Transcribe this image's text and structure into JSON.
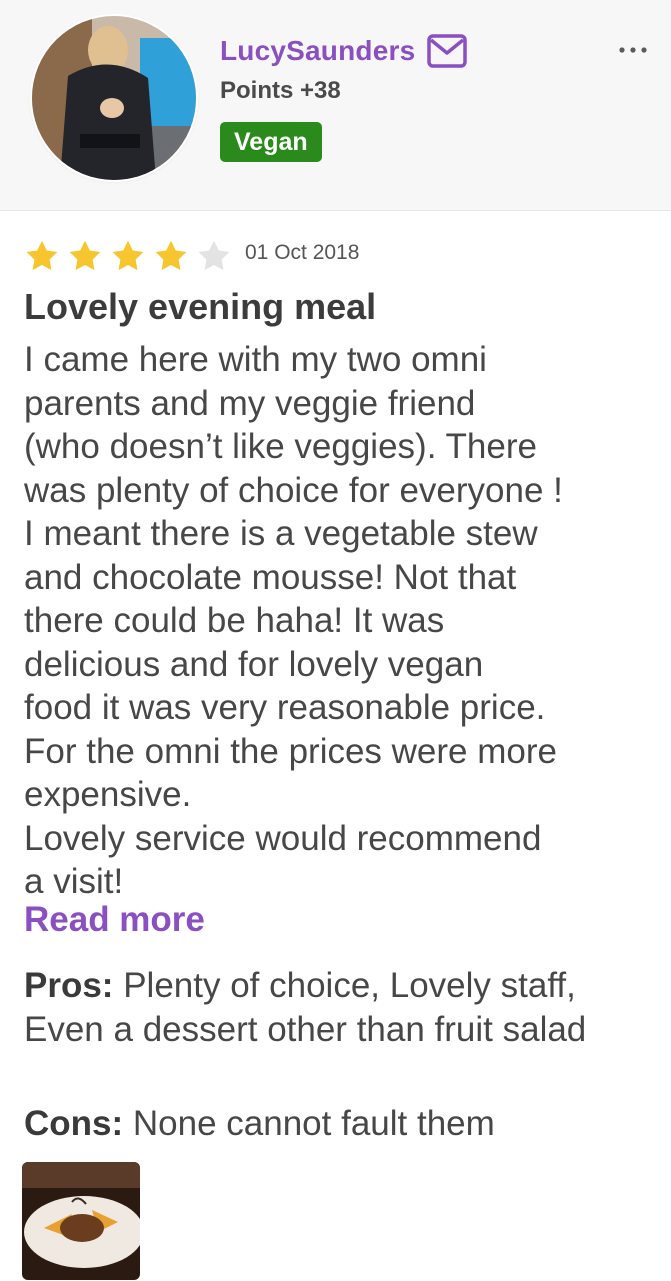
{
  "profile": {
    "username": "LucySaunders",
    "points": "Points +38",
    "badge": "Vegan"
  },
  "review": {
    "rating": 4,
    "rating_max": 5,
    "date": "01 Oct 2018",
    "title": "Lovely evening meal",
    "body_lines": [
      "I came here with my two omni",
      "parents and my veggie friend",
      "(who doesn’t like veggies). There",
      "was plenty of choice for everyone !",
      "I meant there is a vegetable stew",
      "and chocolate mousse! Not that",
      "there could be haha! It was",
      "delicious and for lovely vegan",
      "food it was very reasonable price.",
      "For the omni the prices were more",
      "expensive.",
      "Lovely service would recommend",
      "a visit!"
    ],
    "read_more": "Read more",
    "pros_label": "Pros:",
    "pros_text": "Plenty of choice, Lovely staff, Even a dessert other than fruit salad",
    "cons_label": "Cons:",
    "cons_text": "None cannot fault them"
  },
  "icons": {
    "message": "mail-icon",
    "menu": "more-options-icon",
    "star": "star-icon"
  },
  "colors": {
    "accent": "#8a4fc0",
    "badge": "#2a8a1c",
    "star_filled": "#f7c62f",
    "star_empty": "#e3e3e3"
  }
}
